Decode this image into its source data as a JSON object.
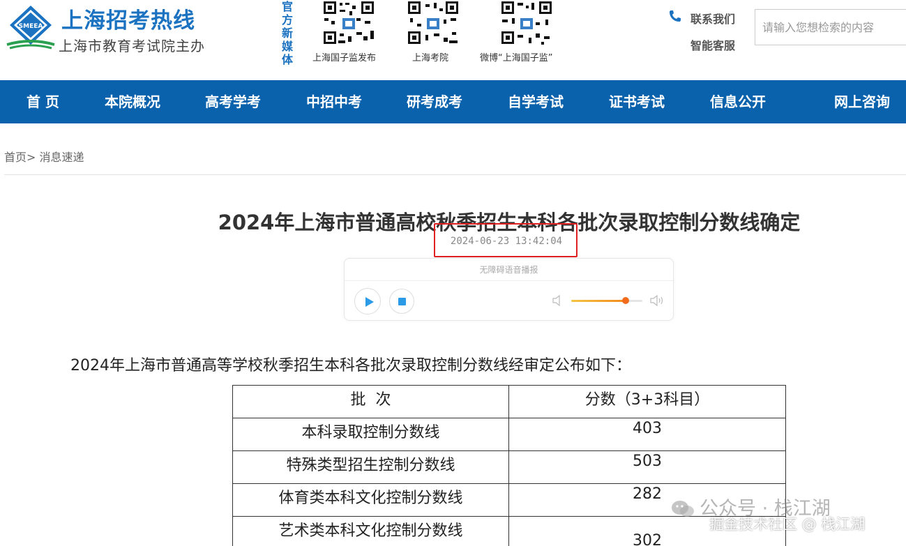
{
  "header": {
    "site_title": "上海招考热线",
    "site_subtitle": "上海市教育考试院主办",
    "logo_text": "SMEEA",
    "media_label": "官方新媒体",
    "qr_codes": [
      {
        "caption": "上海国子监发布"
      },
      {
        "caption": "上海考院"
      },
      {
        "caption": "微博“上海国子监”"
      }
    ],
    "contact_label": "联系我们",
    "service_label": "智能客服",
    "search_placeholder": "请输入您想检索的内容"
  },
  "nav": {
    "items": [
      "首 页",
      "本院概况",
      "高考学考",
      "中招中考",
      "研考成考",
      "自学考试",
      "证书考试",
      "信息公开",
      "网上咨询"
    ]
  },
  "breadcrumb": {
    "home": "首页",
    "separator": ">",
    "current": "消息速递"
  },
  "article": {
    "title": "2024年上海市普通高校秋季招生本科各批次录取控制分数线确定",
    "date": "2024-06-23 13:42:04",
    "intro": "2024年上海市普通高等学校秋季招生本科各批次录取控制分数线经审定公布如下："
  },
  "player": {
    "label": "无障碍语音播报",
    "volume_level": 0.76
  },
  "table": {
    "headers": [
      "批  次",
      "分数（3+3科目）"
    ],
    "rows": [
      [
        "本科录取控制分数线",
        "403"
      ],
      [
        "特殊类型招生控制分数线",
        "503"
      ],
      [
        "体育类本科文化控制分数线",
        "282"
      ],
      [
        "艺术类本科文化控制分数线",
        "302"
      ]
    ]
  },
  "watermark": {
    "line1": "公众号 · 栈江湖",
    "line2": "掘金技术社区 @ 栈江湖"
  },
  "colors": {
    "brand_blue": "#0a62ad",
    "title_blue": "#1a72c0",
    "highlight_red": "#e02020"
  }
}
